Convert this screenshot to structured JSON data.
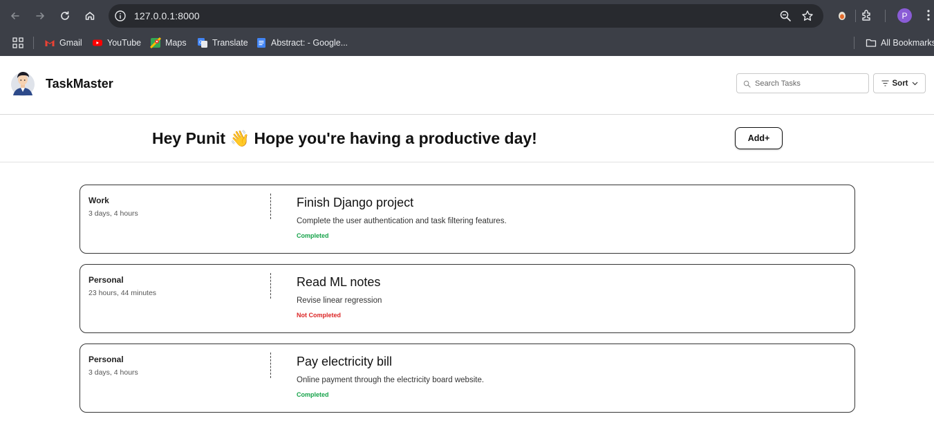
{
  "browser": {
    "url": "127.0.0.1:8000",
    "profile_initial": "P",
    "bookmarks": [
      {
        "label": "Gmail",
        "icon": "gmail-icon"
      },
      {
        "label": "YouTube",
        "icon": "youtube-icon"
      },
      {
        "label": "Maps",
        "icon": "maps-icon"
      },
      {
        "label": "Translate",
        "icon": "translate-icon"
      },
      {
        "label": "Abstract: - Google...",
        "icon": "docs-icon"
      }
    ],
    "all_bookmarks_label": "All Bookmarks"
  },
  "app": {
    "brand": "TaskMaster",
    "search_placeholder": "Search Tasks",
    "sort_label": "Sort",
    "greeting": "Hey Punit 👋 Hope you're having a productive day!",
    "add_label": "Add+"
  },
  "colors": {
    "completed": "#16a34a",
    "not_completed": "#dc2626"
  },
  "tasks": [
    {
      "category": "Work",
      "time": "3 days, 4 hours",
      "title": "Finish Django project",
      "description": "Complete the user authentication and task filtering features.",
      "status": "Completed"
    },
    {
      "category": "Personal",
      "time": "23 hours, 44 minutes",
      "title": "Read ML notes",
      "description": "Revise linear regression",
      "status": "Not Completed"
    },
    {
      "category": "Personal",
      "time": "3 days, 4 hours",
      "title": "Pay electricity bill",
      "description": "Online payment through the electricity board website.",
      "status": "Completed"
    }
  ]
}
